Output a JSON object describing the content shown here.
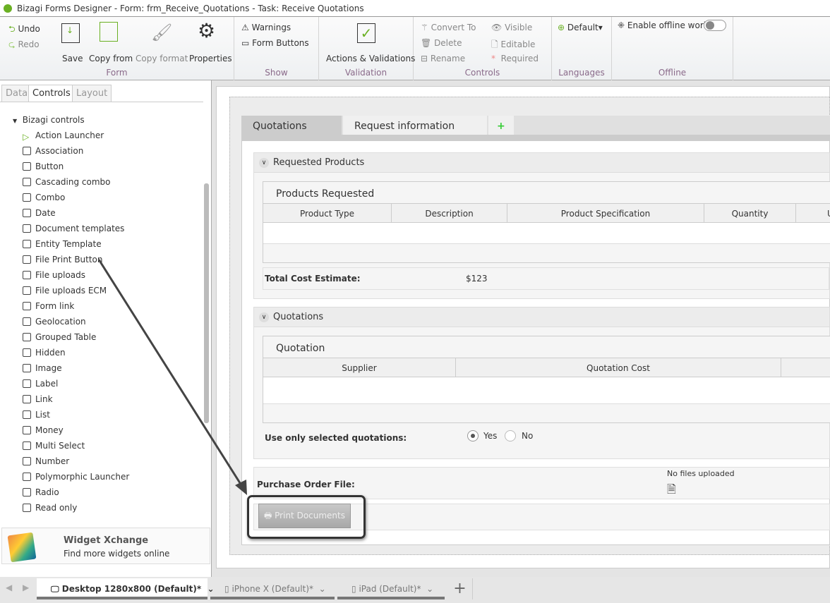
{
  "window": {
    "title": "Bizagi Forms Designer  - Form: frm_Receive_Quotations - Task:  Receive Quotations"
  },
  "ribbon": {
    "form": {
      "label": "Form",
      "undo": "Undo",
      "redo": "Redo",
      "save": "Save",
      "copy_from": "Copy from",
      "copy_format": "Copy format",
      "properties": "Properties"
    },
    "show": {
      "label": "Show",
      "warnings": "Warnings",
      "form_buttons": "Form Buttons"
    },
    "validation": {
      "label": "Validation",
      "actions": "Actions & Validations"
    },
    "controls": {
      "label": "Controls",
      "convert_to": "Convert To",
      "delete": "Delete",
      "rename": "Rename",
      "visible": "Visible",
      "editable": "Editable",
      "required": "Required"
    },
    "languages": {
      "label": "Languages",
      "default": "Default"
    },
    "offline": {
      "label": "Offline",
      "enable": "Enable offline work",
      "enabled": false
    }
  },
  "left_panel": {
    "tabs": [
      {
        "label": "Data"
      },
      {
        "label": "Controls",
        "active": true
      },
      {
        "label": "Layout"
      }
    ],
    "tree_root": "Bizagi controls",
    "items": [
      "Action Launcher",
      "Association",
      "Button",
      "Cascading combo",
      "Combo",
      "Date",
      "Document templates",
      "Entity Template",
      "File Print Button",
      "File uploads",
      "File uploads ECM",
      "Form link",
      "Geolocation",
      "Grouped Table",
      "Hidden",
      "Image",
      "Label",
      "Link",
      "List",
      "Money",
      "Multi Select",
      "Number",
      "Polymorphic Launcher",
      "Radio",
      "Read only"
    ],
    "widget": {
      "title": "Widget Xchange",
      "subtitle": "Find more widgets online"
    }
  },
  "form": {
    "tabs": [
      {
        "label": "Quotations",
        "active": true
      },
      {
        "label": "Request information"
      }
    ],
    "requested_products": {
      "title": "Requested Products",
      "grid_title": "Products Requested",
      "columns": [
        "Product Type",
        "Description",
        "Product Specification",
        "Quantity",
        "U"
      ],
      "total_label": "Total Cost Estimate:",
      "total_value": "$123"
    },
    "quotations": {
      "title": "Quotations",
      "grid_title": "Quotation",
      "columns": [
        "Supplier",
        "Quotation Cost"
      ],
      "use_selected_label": "Use only selected quotations:",
      "options": [
        "Yes",
        "No"
      ],
      "selected": "Yes"
    },
    "purchase_order": {
      "label": "Purchase Order File:",
      "status": "No files uploaded"
    },
    "print_button": "Print Documents"
  },
  "bottom_tabs": [
    {
      "label": "Desktop 1280x800 (Default)",
      "modified": "*",
      "active": true
    },
    {
      "label": "iPhone X (Default)",
      "modified": "*"
    },
    {
      "label": "iPad (Default)",
      "modified": "*"
    }
  ],
  "colors": {
    "accent": "#6ab023",
    "group_label": "#8a6a8a",
    "highlight_border": "#333333"
  }
}
